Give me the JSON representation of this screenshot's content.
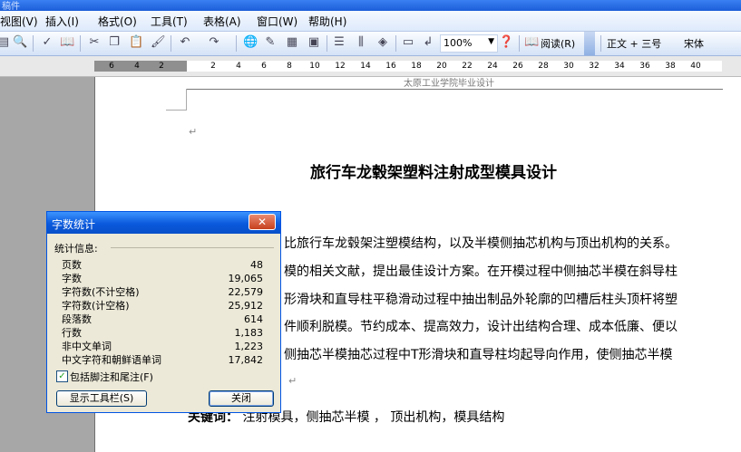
{
  "window": {
    "title": "稿件"
  },
  "menu": [
    {
      "label": "视图(V)"
    },
    {
      "label": "插入(I)"
    },
    {
      "label": "格式(O)"
    },
    {
      "label": "工具(T)"
    },
    {
      "label": "表格(A)"
    },
    {
      "label": "窗口(W)"
    },
    {
      "label": "帮助(H)"
    }
  ],
  "toolbar": {
    "zoom": "100%",
    "read_label": "阅读(R)",
    "style_value": "正文 + 三号",
    "font_value": "宋体"
  },
  "ruler": {
    "left_ticks": [
      "6",
      "4",
      "2"
    ],
    "right_ticks": [
      "2",
      "4",
      "6",
      "8",
      "10",
      "12",
      "14",
      "16",
      "18",
      "20",
      "22",
      "24",
      "26",
      "28",
      "30",
      "32",
      "34",
      "36",
      "38",
      "40"
    ]
  },
  "document": {
    "header_text": "太原工业学院毕业设计",
    "title": "旅行车龙毂架塑料注射成型模具设计",
    "lines": [
      "比旅行车龙毂架注塑模结构，以及半模侧抽芯机构与顶出机构的关系。",
      "模的相关文献，提出最佳设计方案。在开模过程中侧抽芯半模在斜导柱",
      "形滑块和直导柱平稳滑动过程中抽出制品外轮廓的凹槽后柱头顶杆将塑",
      "件顺利脱模。节约成本、提高效力，设计出结构合理、成本低廉、便以",
      "侧抽芯半模抽芯过程中T形滑块和直导柱均起导向作用，使侧抽芯半模"
    ],
    "keywords_label": "关键词：",
    "keywords_text": "注射模具，侧抽芯半模 ， 顶出机构，模具结构"
  },
  "dialog": {
    "title": "字数统计",
    "section_label": "统计信息:",
    "stats": [
      {
        "label": "页数",
        "value": "48"
      },
      {
        "label": "字数",
        "value": "19,065"
      },
      {
        "label": "字符数(不计空格)",
        "value": "22,579"
      },
      {
        "label": "字符数(计空格)",
        "value": "25,912"
      },
      {
        "label": "段落数",
        "value": "614"
      },
      {
        "label": "行数",
        "value": "1,183"
      },
      {
        "label": "非中文单词",
        "value": "1,223"
      },
      {
        "label": "中文字符和朝鲜语单词",
        "value": "17,842"
      }
    ],
    "checkbox_label": "包括脚注和尾注(F)",
    "checkbox_checked": true,
    "toolbar_button": "显示工具栏(S)",
    "close_button": "关闭"
  }
}
